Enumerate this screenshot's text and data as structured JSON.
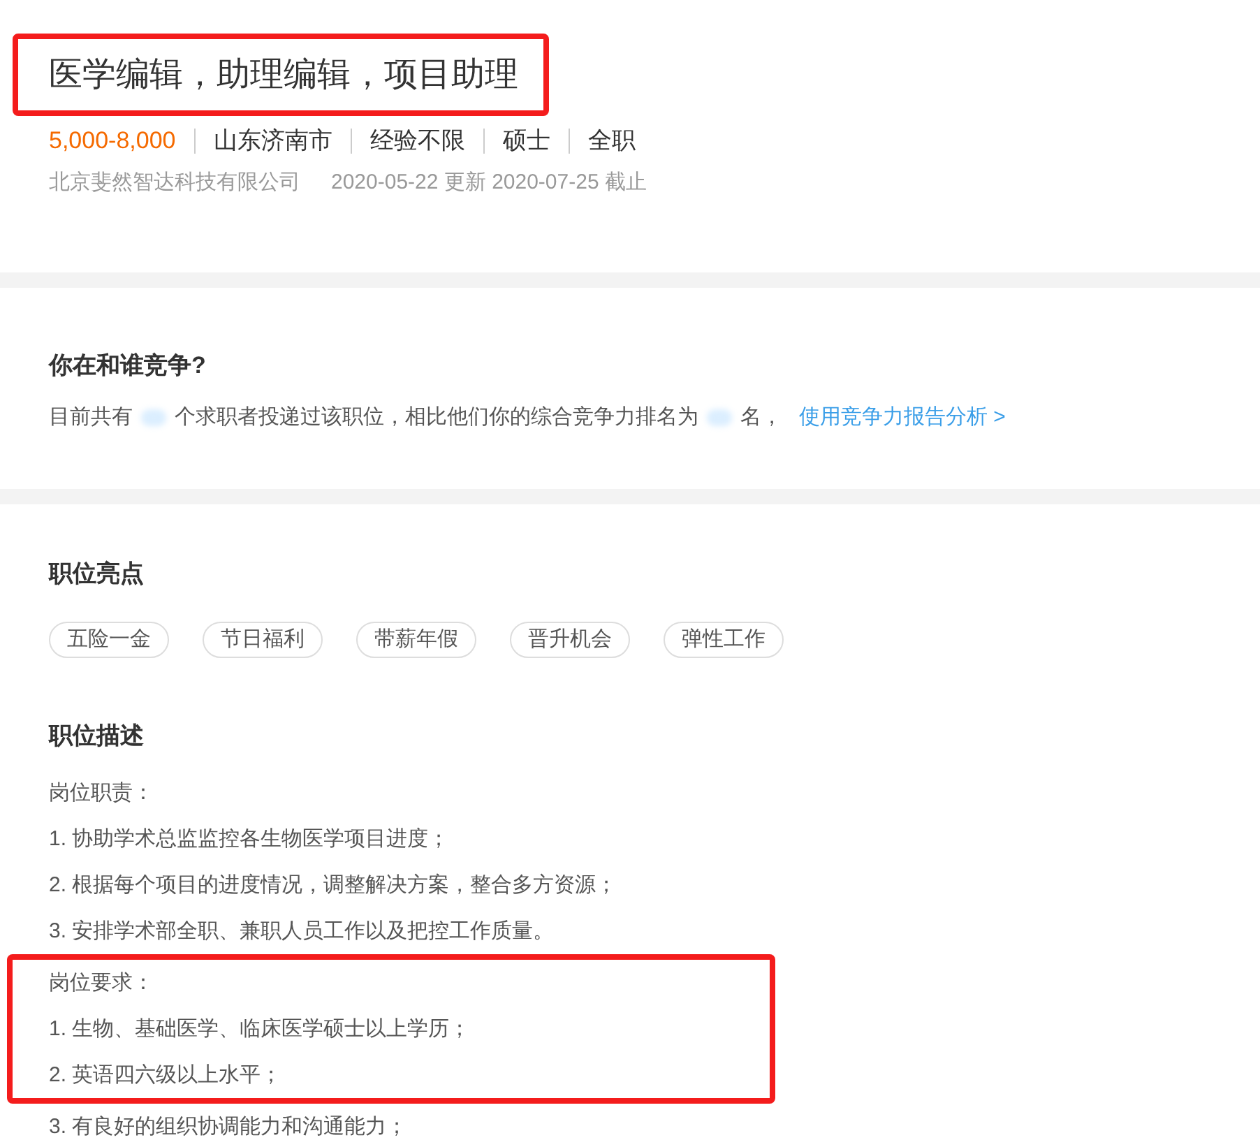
{
  "job": {
    "title": "医学编辑，助理编辑，项目助理",
    "title_highlighted": true,
    "salary": "5,000-8,000",
    "attributes": [
      "山东济南市",
      "经验不限",
      "硕士",
      "全职"
    ],
    "company": "北京斐然智达科技有限公司",
    "dates": "2020-05-22 更新 2020-07-25 截止"
  },
  "competition": {
    "heading": "你在和谁竞争?",
    "parts": [
      {
        "kind": "text",
        "text": "目前共有"
      },
      {
        "kind": "blur"
      },
      {
        "kind": "text",
        "text": "个求职者投递过该职位，相比他们你的综合竞争力排名为"
      },
      {
        "kind": "blur"
      },
      {
        "kind": "text",
        "text": "名，"
      },
      {
        "kind": "link",
        "text": "使用竞争力报告分析 >"
      }
    ]
  },
  "highlights": {
    "heading": "职位亮点",
    "tags": [
      "五险一金",
      "节日福利",
      "带薪年假",
      "晋升机会",
      "弹性工作"
    ]
  },
  "description": {
    "heading": "职位描述",
    "blocks": [
      {
        "highlighted": false,
        "lines": [
          "岗位职责：",
          "1. 协助学术总监监控各生物医学项目进度；",
          "2. 根据每个项目的进度情况，调整解决方案，整合多方资源；",
          "3. 安排学术部全职、兼职人员工作以及把控工作质量。"
        ]
      },
      {
        "highlighted": true,
        "lines": [
          "岗位要求：",
          "1. 生物、基础医学、临床医学硕士以上学历；",
          "2. 英语四六级以上水平；"
        ]
      },
      {
        "highlighted": false,
        "lines": [
          "3. 有良好的组织协调能力和沟通能力；"
        ]
      }
    ]
  }
}
